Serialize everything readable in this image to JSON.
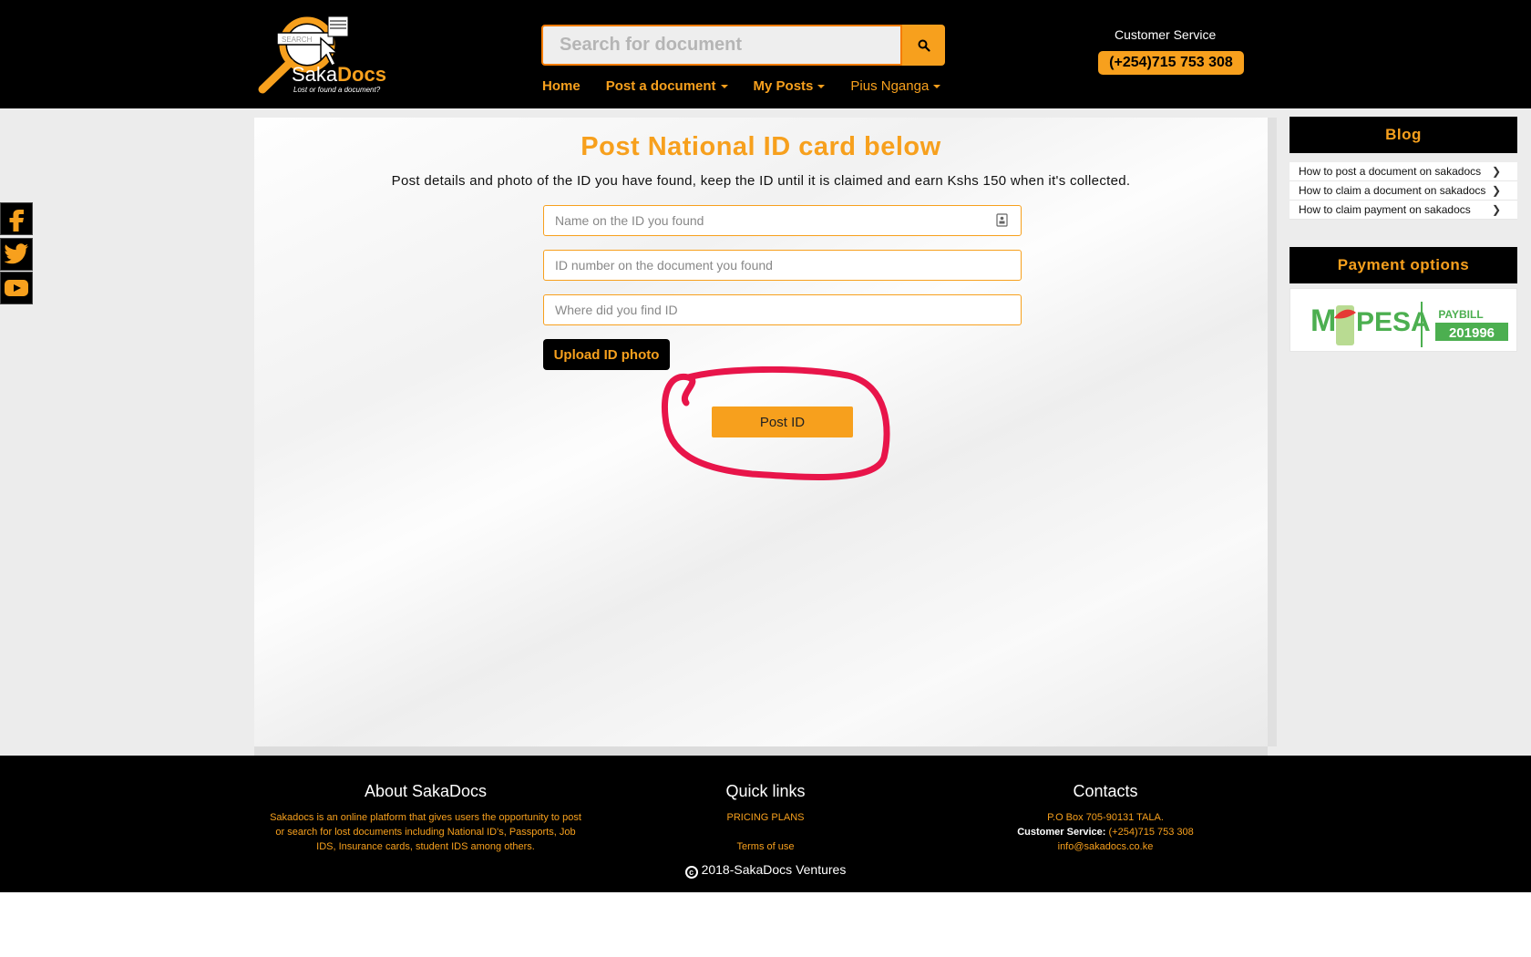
{
  "brand": {
    "logo_search": "SEARCH",
    "name_saka": "Saka",
    "name_docs": "Docs",
    "tagline": "Lost or found a document?",
    "accent": "#f7a01d"
  },
  "search": {
    "placeholder": "Search for document",
    "button_icon": "search-icon"
  },
  "nav": {
    "home": "Home",
    "post": "Post a document",
    "my_posts": "My Posts",
    "user": "Pius Nganga"
  },
  "customer_service": {
    "label": "Customer Service",
    "phone": "(+254)715 753 308"
  },
  "social": [
    "facebook-icon",
    "twitter-icon",
    "youtube-icon"
  ],
  "main": {
    "title": "Post National ID card below",
    "subtitle": "Post details and photo of the ID you have found, keep the ID until it is claimed and earn Kshs 150 when it's collected.",
    "fields": {
      "name_placeholder": "Name on the ID you found",
      "number_placeholder": "ID number on the document you found",
      "location_placeholder": "Where did you find ID"
    },
    "upload_label": "Upload ID photo",
    "post_label": "Post ID"
  },
  "sidebar": {
    "blog_title": "Blog",
    "blog_items": [
      "How to post a document on sakadocs",
      "How to claim a document on sakadocs",
      "How to claim payment on sakadocs"
    ],
    "payment_title": "Payment options",
    "mpesa": {
      "logo_m": "M",
      "logo_pesa": "PESA",
      "paybill_label": "PAYBILL",
      "paybill_number": "201996"
    }
  },
  "footer": {
    "about_title": "About SakaDocs",
    "about_text": "Sakadocs is an online platform that gives users the opportunity to post or search for lost documents including National ID's, Passports, Job IDS, Insurance cards, student IDS among others.",
    "quick_title": "Quick links",
    "quick_links": [
      "PRICING PLANS",
      "Terms of use"
    ],
    "contacts_title": "Contacts",
    "address": "P.O Box 705-90131 TALA.",
    "cs_label": "Customer Service:",
    "cs_phone": "(+254)715 753 308",
    "email": "info@sakadocs.co.ke",
    "copyright": "2018-SakaDocs Ventures"
  }
}
